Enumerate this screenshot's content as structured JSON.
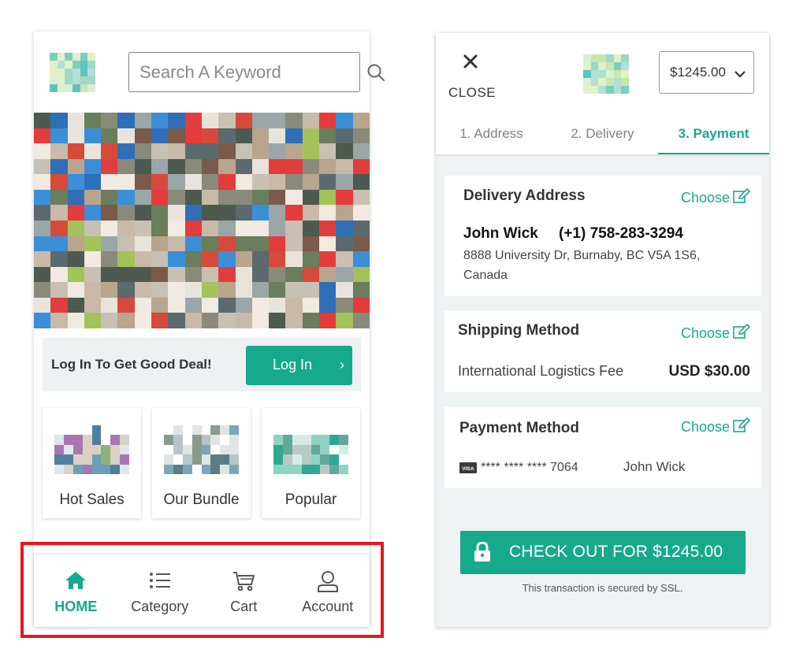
{
  "colors": {
    "accent": "#17a98c",
    "highlight": "#e8141b",
    "panel_bg": "#eef2f2"
  },
  "home": {
    "logo_icon": "brand-logo-pixelated",
    "search": {
      "placeholder": "Search A Keyword",
      "icon": "search-icon"
    },
    "banner_icon": "promo-banner-pixelated",
    "login_promo": {
      "text": "Log In To Get Good Deal!",
      "button_label": "Log In",
      "button_chevron": "›"
    },
    "categories": [
      {
        "label": "Hot Sales"
      },
      {
        "label": "Our Bundle"
      },
      {
        "label": "Popular"
      }
    ],
    "bottom_nav": [
      {
        "label": "HOME",
        "icon": "home-icon",
        "active": true
      },
      {
        "label": "Category",
        "icon": "list-icon",
        "active": false
      },
      {
        "label": "Cart",
        "icon": "cart-icon",
        "active": false
      },
      {
        "label": "Account",
        "icon": "user-icon",
        "active": false
      }
    ]
  },
  "checkout": {
    "close_label": "CLOSE",
    "price_selector": "$1245.00",
    "tabs": [
      {
        "label": "1. Address",
        "active": false
      },
      {
        "label": "2. Delivery",
        "active": false
      },
      {
        "label": "3. Payment",
        "active": true
      }
    ],
    "delivery": {
      "title": "Delivery Address",
      "choose": "Choose",
      "name": "John Wick",
      "phone": "(+1) 758-283-3294",
      "address": "8888 University Dr, Burnaby, BC V5A 1S6, Canada"
    },
    "shipping": {
      "title": "Shipping Method",
      "choose": "Choose",
      "method": "International Logistics Fee",
      "fee": "USD $30.00"
    },
    "payment": {
      "title": "Payment Method",
      "choose": "Choose",
      "card_brand_icon": "visa-card-icon",
      "card_number": "**** **** **** 7064",
      "card_holder": "John Wick"
    },
    "checkout_button": "CHECK OUT FOR $1245.00",
    "ssl_note": "This transaction is secured by SSL."
  }
}
